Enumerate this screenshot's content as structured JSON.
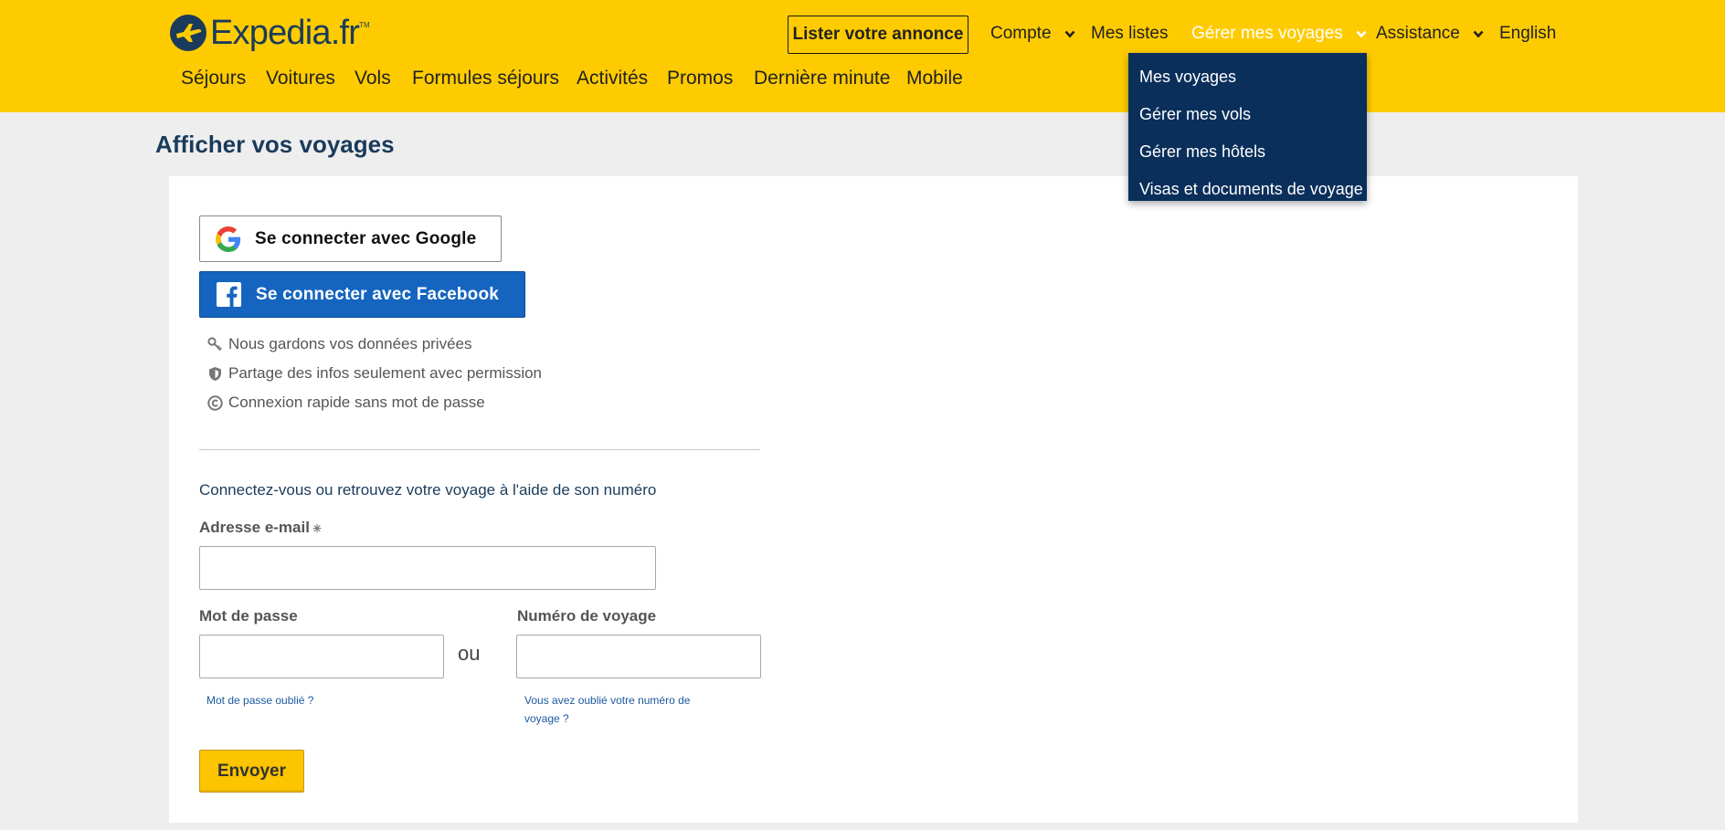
{
  "header": {
    "logo_text": "Expedia.fr",
    "logo_tm": "TM",
    "list_button": "Lister votre annonce",
    "topnav": {
      "account": "Compte",
      "lists": "Mes listes",
      "manage_trips": "Gérer mes voyages",
      "support": "Assistance",
      "language": "English"
    },
    "mainnav": [
      "Séjours",
      "Voitures",
      "Vols",
      "Formules séjours",
      "Activités",
      "Promos",
      "Dernière minute",
      "Mobile"
    ],
    "active_color": "#ffffff",
    "brand_color": "#fecb00"
  },
  "dropdown": {
    "items": [
      "Mes voyages",
      "Gérer mes vols",
      "Gérer mes hôtels",
      "Visas et documents de voyage"
    ],
    "bg_color": "#0a2f5b"
  },
  "page": {
    "title": "Afficher vos voyages"
  },
  "social": {
    "google_label": "Se connecter avec Google",
    "facebook_label": "Se connecter avec Facebook",
    "facebook_color": "#1565c0"
  },
  "features": [
    {
      "icon": "key-icon",
      "text": "Nous gardons vos données privées"
    },
    {
      "icon": "shield-icon",
      "text": "Partage des infos seulement avec permission"
    },
    {
      "icon": "copyright-icon",
      "text": "Connexion rapide sans mot de passe"
    }
  ],
  "form": {
    "intro": "Connectez-vous ou retrouvez votre voyage à l'aide de son numéro",
    "email_label": "Adresse e-mail",
    "email_required_mark": "✳",
    "email_value": "",
    "password_label": "Mot de passe",
    "password_value": "",
    "or_text": "ou",
    "trip_label": "Numéro de voyage",
    "trip_value": "",
    "forgot_password": "Mot de passe oublié ?",
    "forgot_trip_line1": "Vous avez oublié votre numéro de",
    "forgot_trip_line2": "voyage ?",
    "submit": "Envoyer"
  }
}
